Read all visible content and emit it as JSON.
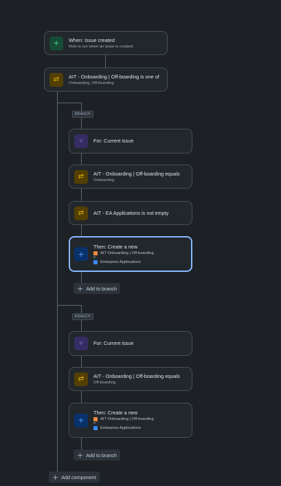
{
  "trigger": {
    "title": "When: Issue created",
    "subtitle": "Rule is run when an issue is created."
  },
  "condition": {
    "title": "AIT - Onboarding | Off-boarding is one of",
    "subtitle": "Onboarding, Off-boarding"
  },
  "branches": [
    {
      "badge": "BRANCH",
      "for": {
        "title": "For: Current issue"
      },
      "condition1": {
        "title": "AIT - Onboarding | Off-boarding equals",
        "subtitle": "Onboarding"
      },
      "condition2": {
        "title": "AIT - EA Applications is not empty"
      },
      "action": {
        "title": "Then: Create a new",
        "project1": "AIT Onboarding | Off-boarding",
        "in_label": "in",
        "project2": "Enterprise Applications"
      },
      "add_label": "Add to branch"
    },
    {
      "badge": "BRANCH",
      "for": {
        "title": "For: Current issue"
      },
      "condition1": {
        "title": "AIT - Onboarding | Off-boarding equals",
        "subtitle": "Off-boarding"
      },
      "action": {
        "title": "Then: Create a new",
        "project1": "AIT Onboarding | Off-boarding",
        "in_label": "in",
        "project2": "Enterprise Applications"
      },
      "add_label": "Add to branch"
    }
  ],
  "add_component_label": "Add component",
  "icons": {
    "trigger": "plus-icon",
    "condition": "shuffle-icon",
    "branch": "branch-icon",
    "action": "plus-icon"
  },
  "colors": {
    "selected_border": "#85b8ff",
    "background": "#1d2125"
  }
}
